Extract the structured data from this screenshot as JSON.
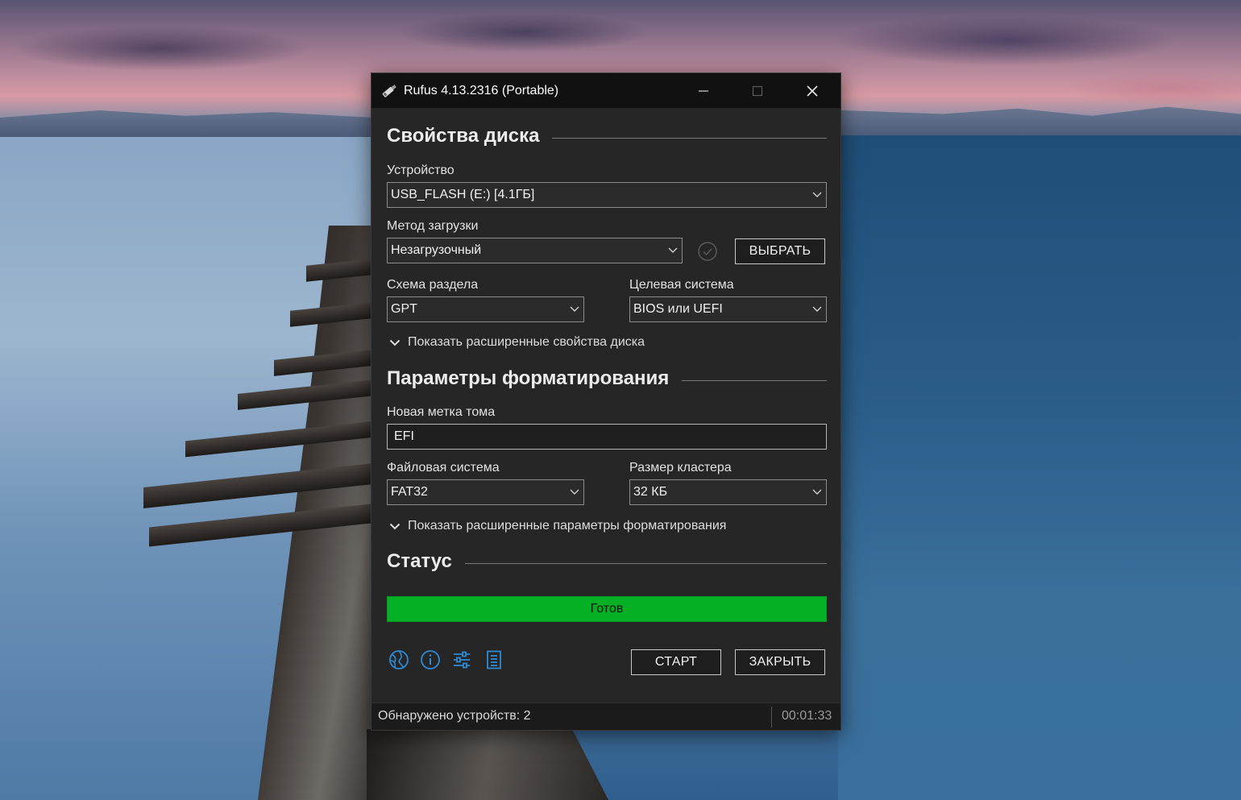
{
  "window": {
    "title": "Rufus 4.13.2316 (Portable)"
  },
  "drive_properties": {
    "heading": "Свойства диска",
    "device_label": "Устройство",
    "device_value": "USB_FLASH (E:) [4.1ГБ]",
    "boot_label": "Метод загрузки",
    "boot_value": "Незагрузочный",
    "select_button": "ВЫБРАТЬ",
    "partition_label": "Схема раздела",
    "partition_value": "GPT",
    "target_label": "Целевая система",
    "target_value": "BIOS или UEFI",
    "advanced_toggle": "Показать расширенные свойства диска"
  },
  "format_options": {
    "heading": "Параметры форматирования",
    "volume_label": "Новая метка тома",
    "volume_value": "EFI",
    "filesystem_label": "Файловая система",
    "filesystem_value": "FAT32",
    "cluster_label": "Размер кластера",
    "cluster_value": "32 КБ",
    "advanced_toggle": "Показать расширенные параметры форматирования"
  },
  "status": {
    "heading": "Статус",
    "progress_text": "Готов",
    "progress_fraction": 1.0
  },
  "actions": {
    "start_button": "СТАРТ",
    "close_button": "ЗАКРЫТЬ",
    "toolbar_icons": [
      "globe-icon",
      "info-icon",
      "settings-sliders-icon",
      "log-icon"
    ]
  },
  "statusbar": {
    "text": "Обнаружено устройств: 2",
    "timer": "00:01:33"
  },
  "colors": {
    "accent_icon": "#2e8bd6",
    "progress_green": "#06b025",
    "window_bg": "#262626",
    "titlebar_bg": "#111111"
  }
}
